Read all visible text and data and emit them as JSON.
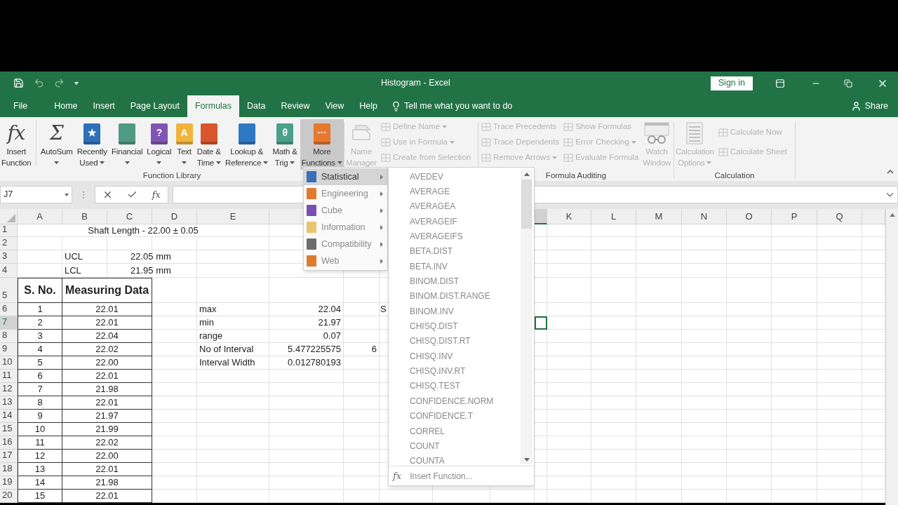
{
  "window": {
    "title": "Histogram - Excel",
    "sign_in": "Sign in"
  },
  "tabs": [
    {
      "label": "File",
      "selected": false
    },
    {
      "label": "Home",
      "selected": false
    },
    {
      "label": "Insert",
      "selected": false
    },
    {
      "label": "Page Layout",
      "selected": false
    },
    {
      "label": "Formulas",
      "selected": true
    },
    {
      "label": "Data",
      "selected": false
    },
    {
      "label": "Review",
      "selected": false
    },
    {
      "label": "View",
      "selected": false
    },
    {
      "label": "Help",
      "selected": false
    }
  ],
  "tell_me": "Tell me what you want to do",
  "share": "Share",
  "ribbon": {
    "function_library": {
      "label": "Function Library",
      "buttons": [
        {
          "kind": "glyph",
          "glyph": "fx",
          "lines": [
            "Insert",
            "Function"
          ],
          "dropdown": false,
          "open": false
        },
        {
          "kind": "glyph",
          "glyph": "Σ",
          "lines": [
            "AutoSum"
          ],
          "dropdown": true,
          "open": false
        },
        {
          "kind": "book",
          "color": "#2e6fba",
          "glyph": "★",
          "lines": [
            "Recently",
            "Used"
          ],
          "dropdown": true,
          "open": false
        },
        {
          "kind": "book",
          "color": "#4f9a82",
          "lines": [
            "Financial"
          ],
          "dropdown": true,
          "open": false
        },
        {
          "kind": "book",
          "color": "#8055b5",
          "glyph": "?",
          "lines": [
            "Logical"
          ],
          "dropdown": true,
          "open": false
        },
        {
          "kind": "book",
          "color": "#f0b43c",
          "glyph": "A",
          "lines": [
            "Text"
          ],
          "dropdown": true,
          "open": false
        },
        {
          "kind": "book",
          "color": "#d9552b",
          "lines": [
            "Date &",
            "Time"
          ],
          "dropdown": true,
          "open": false
        },
        {
          "kind": "book",
          "color": "#2f78c4",
          "lines": [
            "Lookup &",
            "Reference"
          ],
          "dropdown": true,
          "open": false
        },
        {
          "kind": "book",
          "color": "#4aa08a",
          "glyph": "θ",
          "lines": [
            "Math &",
            "Trig"
          ],
          "dropdown": true,
          "open": false
        },
        {
          "kind": "book",
          "color": "#e8772e",
          "glyph": "···",
          "lines": [
            "More",
            "Functions"
          ],
          "dropdown": true,
          "open": true
        }
      ]
    },
    "defined_names": {
      "large": {
        "kind": "tag",
        "lines": [
          "Name",
          "Manager"
        ],
        "dropdown": false,
        "disabled": true
      },
      "small": [
        {
          "label": "Define Name",
          "dropdown": true,
          "disabled": true
        },
        {
          "label": "Use in Formula",
          "dropdown": true,
          "disabled": true
        },
        {
          "label": "Create from Selection",
          "dropdown": false,
          "disabled": true
        }
      ]
    },
    "formula_auditing": {
      "label": "Formula Auditing",
      "small": [
        {
          "label": "Trace Precedents",
          "dropdown": false,
          "disabled": true
        },
        {
          "label": "Trace Dependents",
          "dropdown": false,
          "disabled": true
        },
        {
          "label": "Remove Arrows",
          "dropdown": true,
          "disabled": true
        },
        {
          "label": "Show Formulas",
          "dropdown": false,
          "disabled": true
        },
        {
          "label": "Error Checking",
          "dropdown": true,
          "disabled": true
        },
        {
          "label": "Evaluate Formula",
          "dropdown": false,
          "disabled": true
        }
      ],
      "large": {
        "kind": "glasses",
        "lines": [
          "Watch",
          "Window"
        ],
        "dropdown": false,
        "disabled": true
      }
    },
    "calculation": {
      "label": "Calculation",
      "large": {
        "kind": "calculator",
        "lines": [
          "Calculation",
          "Options"
        ],
        "dropdown": true,
        "disabled": true
      },
      "small": [
        {
          "label": "Calculate Now",
          "dropdown": false,
          "disabled": true
        },
        {
          "label": "Calculate Sheet",
          "dropdown": false,
          "disabled": true
        }
      ]
    }
  },
  "formula_bar": {
    "name_box": "J7",
    "fx": "fx"
  },
  "sheet": {
    "columns_left": [
      "A",
      "B",
      "C",
      "D",
      "E"
    ],
    "columns_right": [
      "K",
      "L",
      "M",
      "N",
      "O",
      "P",
      "Q"
    ],
    "row_numbers": [
      {
        "label": "1",
        "selected": false
      },
      {
        "label": "2",
        "selected": false
      },
      {
        "label": "3",
        "selected": false
      },
      {
        "label": "4",
        "selected": false
      },
      {
        "label": "5",
        "selected": false
      },
      {
        "label": "6",
        "selected": false
      },
      {
        "label": "7",
        "selected": true
      },
      {
        "label": "8",
        "selected": false
      },
      {
        "label": "9",
        "selected": false
      },
      {
        "label": "10",
        "selected": false
      },
      {
        "label": "11",
        "selected": false
      },
      {
        "label": "12",
        "selected": false
      },
      {
        "label": "13",
        "selected": false
      },
      {
        "label": "14",
        "selected": false
      },
      {
        "label": "15",
        "selected": false
      },
      {
        "label": "16",
        "selected": false
      },
      {
        "label": "17",
        "selected": false
      },
      {
        "label": "18",
        "selected": false
      },
      {
        "label": "19",
        "selected": false
      },
      {
        "label": "20",
        "selected": false
      }
    ],
    "title": "Shaft Length - 22.00 ± 0.05",
    "limits": [
      {
        "label": "UCL",
        "value": "22.05 mm"
      },
      {
        "label": "LCL",
        "value": "21.95 mm"
      }
    ],
    "table": {
      "columns": [
        "S. No.",
        "Measuring Data"
      ],
      "rows": [
        [
          "1",
          "22.01"
        ],
        [
          "2",
          "22.01"
        ],
        [
          "3",
          "22.04"
        ],
        [
          "4",
          "22.02"
        ],
        [
          "5",
          "22.00"
        ],
        [
          "6",
          "22.01"
        ],
        [
          "7",
          "21.98"
        ],
        [
          "8",
          "22.01"
        ],
        [
          "9",
          "21.97"
        ],
        [
          "10",
          "21.99"
        ],
        [
          "11",
          "22.02"
        ],
        [
          "12",
          "22.00"
        ],
        [
          "13",
          "22.01"
        ],
        [
          "14",
          "21.98"
        ],
        [
          "15",
          "22.01"
        ]
      ]
    },
    "stats": [
      {
        "label": "max",
        "value": "22.04",
        "column_h": "S"
      },
      {
        "label": "min",
        "value": "21.97"
      },
      {
        "label": "range",
        "value": "0.07"
      },
      {
        "label": "No of Interval",
        "value": "5.477225575",
        "column_g": "6"
      },
      {
        "label": "Interval Width",
        "value": "0.012780193"
      }
    ]
  },
  "more_functions_menu": {
    "categories": [
      {
        "label": "Statistical",
        "selected": true,
        "color": "#3a6fb5"
      },
      {
        "label": "Engineering",
        "selected": false,
        "color": "#e07a2e"
      },
      {
        "label": "Cube",
        "selected": false,
        "color": "#7a4fb0"
      },
      {
        "label": "Information",
        "selected": false,
        "color": "#e8c46a"
      },
      {
        "label": "Compatibility",
        "selected": false,
        "color": "#6d6d6d"
      },
      {
        "label": "Web",
        "selected": false,
        "color": "#e07a2e"
      }
    ],
    "functions": [
      "AVEDEV",
      "AVERAGE",
      "AVERAGEA",
      "AVERAGEIF",
      "AVERAGEIFS",
      "BETA.DIST",
      "BETA.INV",
      "BINOM.DIST",
      "BINOM.DIST.RANGE",
      "BINOM.INV",
      "CHISQ.DIST",
      "CHISQ.DIST.RT",
      "CHISQ.INV",
      "CHISQ.INV.RT",
      "CHISQ.TEST",
      "CONFIDENCE.NORM",
      "CONFIDENCE.T",
      "CORREL",
      "COUNT",
      "COUNTA"
    ],
    "footer": "Insert Function...",
    "footer_glyph": "fx"
  }
}
